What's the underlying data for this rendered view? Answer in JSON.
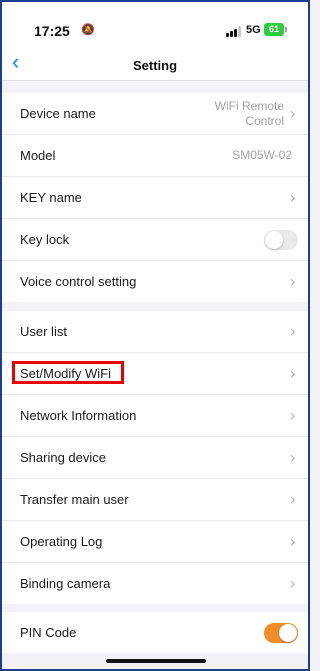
{
  "status": {
    "time": "17:25",
    "network": "5G",
    "battery": "61"
  },
  "nav": {
    "back_icon": "chevron-left-icon",
    "title": "Setting"
  },
  "group1": [
    {
      "label": "Device name",
      "value": "WiFi Remote Control"
    },
    {
      "label": "Model",
      "value": "SM05W-02"
    },
    {
      "label": "KEY name"
    },
    {
      "label": "Key lock",
      "toggle": false
    },
    {
      "label": "Voice control setting"
    }
  ],
  "group2": [
    {
      "label": "User list"
    },
    {
      "label": "Set/Modify WiFi",
      "highlighted": true
    },
    {
      "label": "Network Information"
    },
    {
      "label": "Sharing device"
    },
    {
      "label": "Transfer main user"
    },
    {
      "label": "Operating Log"
    },
    {
      "label": "Binding camera"
    }
  ],
  "group3": [
    {
      "label": "PIN Code",
      "toggle": true
    }
  ],
  "colors": {
    "accent": "#0a84ff",
    "toggle_on": "#f28c28",
    "highlight": "#e60000"
  }
}
